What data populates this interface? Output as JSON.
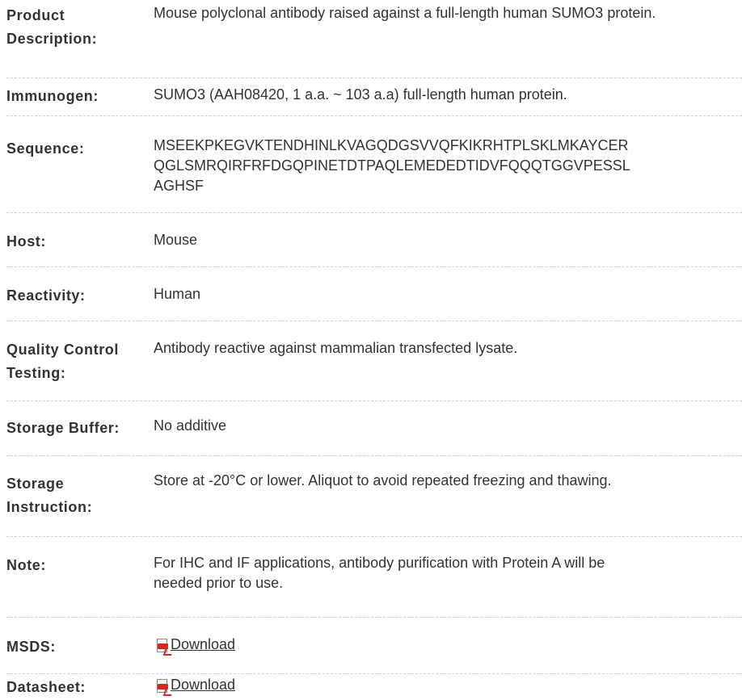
{
  "rows": [
    {
      "label": "Product Description:",
      "value": "Mouse polyclonal antibody raised against a full-length human SUMO3 protein."
    },
    {
      "label": "Immunogen:",
      "value": "SUMO3 (AAH08420, 1 a.a. ~ 103 a.a) full-length human protein."
    },
    {
      "label": "Sequence:",
      "value_lines": [
        "MSEEKPKEGVKTENDHINLKVAGQDGSVVQFKIKRHTPLSKLMKAYCER",
        "QGLSMRQIRFRFDGQPINETDTPAQLEMEDEDTIDVFQQQTGGVPESSL",
        "AGHSF"
      ]
    },
    {
      "label": "Host:",
      "value": "Mouse"
    },
    {
      "label": "Reactivity:",
      "value": "Human"
    },
    {
      "label": "Quality Control Testing:",
      "value": "Antibody reactive against mammalian transfected lysate."
    },
    {
      "label": "Storage Buffer:",
      "value": "No additive"
    },
    {
      "label": "Storage Instruction:",
      "value": "Store at -20°C or lower. Aliquot to avoid repeated freezing and thawing."
    },
    {
      "label": "Note:",
      "value": "For IHC and IF applications, antibody purification with Protein A will be needed prior to use."
    },
    {
      "label": "MSDS:",
      "link": "Download",
      "icon": "pdf-icon"
    },
    {
      "label": "Datasheet:",
      "link": "Download",
      "icon": "pdf-icon"
    }
  ]
}
